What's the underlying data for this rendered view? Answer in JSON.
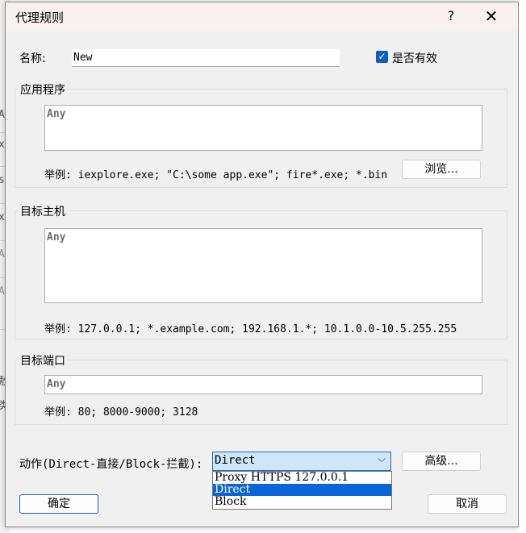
{
  "dialog": {
    "title": "代理规则",
    "help_label": "?",
    "close_label": "✕"
  },
  "name": {
    "label": "名称:",
    "value": "New"
  },
  "enabled": {
    "label": "是否有效",
    "checked": true
  },
  "app_group": {
    "label": "应用程序",
    "placeholder": "Any",
    "hint": "举例: iexplore.exe; \"C:\\some app.exe\"; fire*.exe; *.bin",
    "browse_label": "浏览..."
  },
  "host_group": {
    "label": "目标主机",
    "placeholder": "Any",
    "hint": "举例: 127.0.0.1; *.example.com; 192.168.1.*; 10.1.0.0-10.5.255.255"
  },
  "port_group": {
    "label": "目标端口",
    "placeholder": "Any",
    "hint": "举例: 80; 8000-9000; 3128"
  },
  "action": {
    "label": "动作(Direct-直接/Block-拦截):",
    "selected": "Direct",
    "options": [
      "Proxy HTTPS 127.0.0.1",
      "Direct",
      "Block"
    ],
    "advanced_label": "高级..."
  },
  "footer": {
    "ok_label": "确定",
    "cancel_label": "取消"
  },
  "colors": {
    "accent": "#0a66d8",
    "dialog_bg": "#f0f0f0",
    "title_bg": "#f9f1f0"
  }
}
